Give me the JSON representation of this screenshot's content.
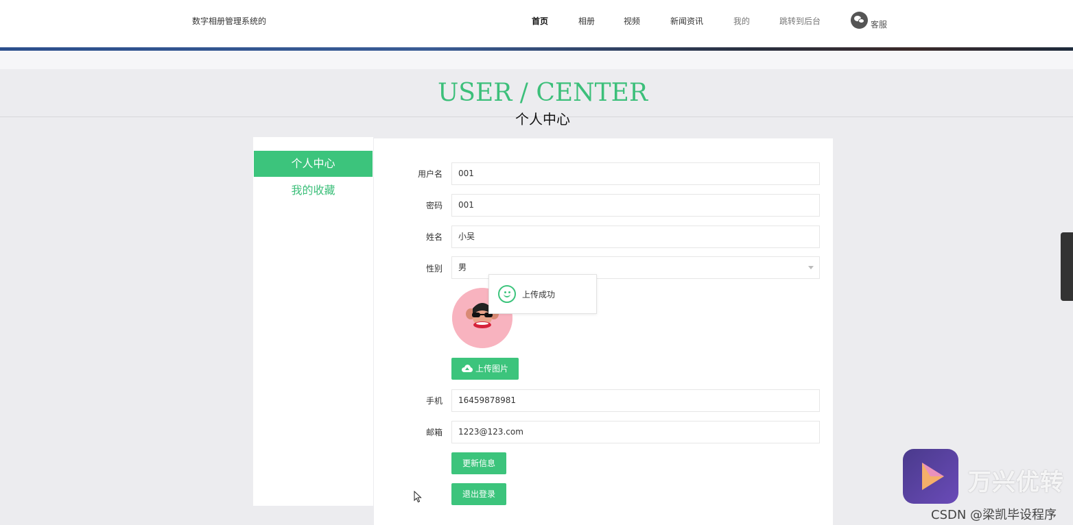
{
  "header": {
    "brand": "数字相册管理系统的",
    "nav": [
      {
        "label": "首页",
        "active": true
      },
      {
        "label": "相册"
      },
      {
        "label": "视频"
      },
      {
        "label": "新闻资讯"
      },
      {
        "label": "我的"
      },
      {
        "label": "跳转到后台"
      }
    ],
    "service_label": "客服",
    "service_icon": "wechat-icon"
  },
  "hero": {
    "title_en": "USER / CENTER",
    "title_cn": "个人中心"
  },
  "sidebar": {
    "items": [
      {
        "label": "个人中心",
        "active": true
      },
      {
        "label": "我的收藏"
      }
    ]
  },
  "form": {
    "username": {
      "label": "用户名",
      "value": "001"
    },
    "password": {
      "label": "密码",
      "value": "001"
    },
    "name": {
      "label": "姓名",
      "value": "小吴"
    },
    "gender": {
      "label": "性别",
      "value": "男"
    },
    "phone": {
      "label": "手机",
      "value": "16459878981"
    },
    "email": {
      "label": "邮箱",
      "value": "1223@123.com"
    },
    "upload_button": "上传图片",
    "update_button": "更新信息",
    "logout_button": "退出登录"
  },
  "toast": {
    "message": "上传成功",
    "icon": "smile-icon"
  },
  "watermark": {
    "app_name": "万兴优转",
    "credit": "CSDN @梁凯毕设程序"
  },
  "colors": {
    "accent": "#3cc47c",
    "title_green": "#3cbf7a"
  }
}
